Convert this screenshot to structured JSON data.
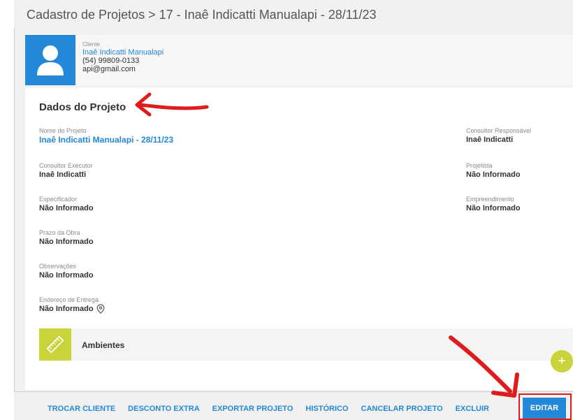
{
  "header": {
    "title": "Cadastro de Projetos > 17 - Inaê Indicatti Manualapi - 28/11/23"
  },
  "client": {
    "caption": "Cliente",
    "name": "Inaê Indicatti Manualapi",
    "phone": "(54) 99809-0133",
    "email": "api@gmail.com"
  },
  "project": {
    "section_title": "Dados do Projeto",
    "fields": [
      {
        "label": "Nome do Projeto",
        "value": "Inaê Indicatti Manualapi - 28/11/23"
      },
      {
        "label": "Consultor Executor",
        "value": "Inaê Indicatti"
      },
      {
        "label": "Especificador",
        "value": "Não Informado"
      },
      {
        "label": "Prazo da Obra",
        "value": "Não Informado"
      },
      {
        "label": "Observações",
        "value": "Não Informado"
      },
      {
        "label": "Endereço de Entrega",
        "value": "Não Informado"
      },
      {
        "label": "Consultor Responsável",
        "value": "Inaê Indicatti"
      },
      {
        "label": "Projetista",
        "value": "Não Informado"
      },
      {
        "label": "Empreendimento",
        "value": "Não Informado"
      }
    ]
  },
  "ambientes": {
    "label": "Ambientes"
  },
  "fab": {
    "symbol": "+"
  },
  "footer": {
    "actions": [
      "TROCAR CLIENTE",
      "DESCONTO EXTRA",
      "EXPORTAR PROJETO",
      "HISTÓRICO",
      "CANCELAR PROJETO",
      "EXCLUIR"
    ],
    "primary": "EDITAR"
  },
  "colors": {
    "accent": "#2488d8",
    "lime": "#c9d43a",
    "annotation": "#e01b1b"
  }
}
